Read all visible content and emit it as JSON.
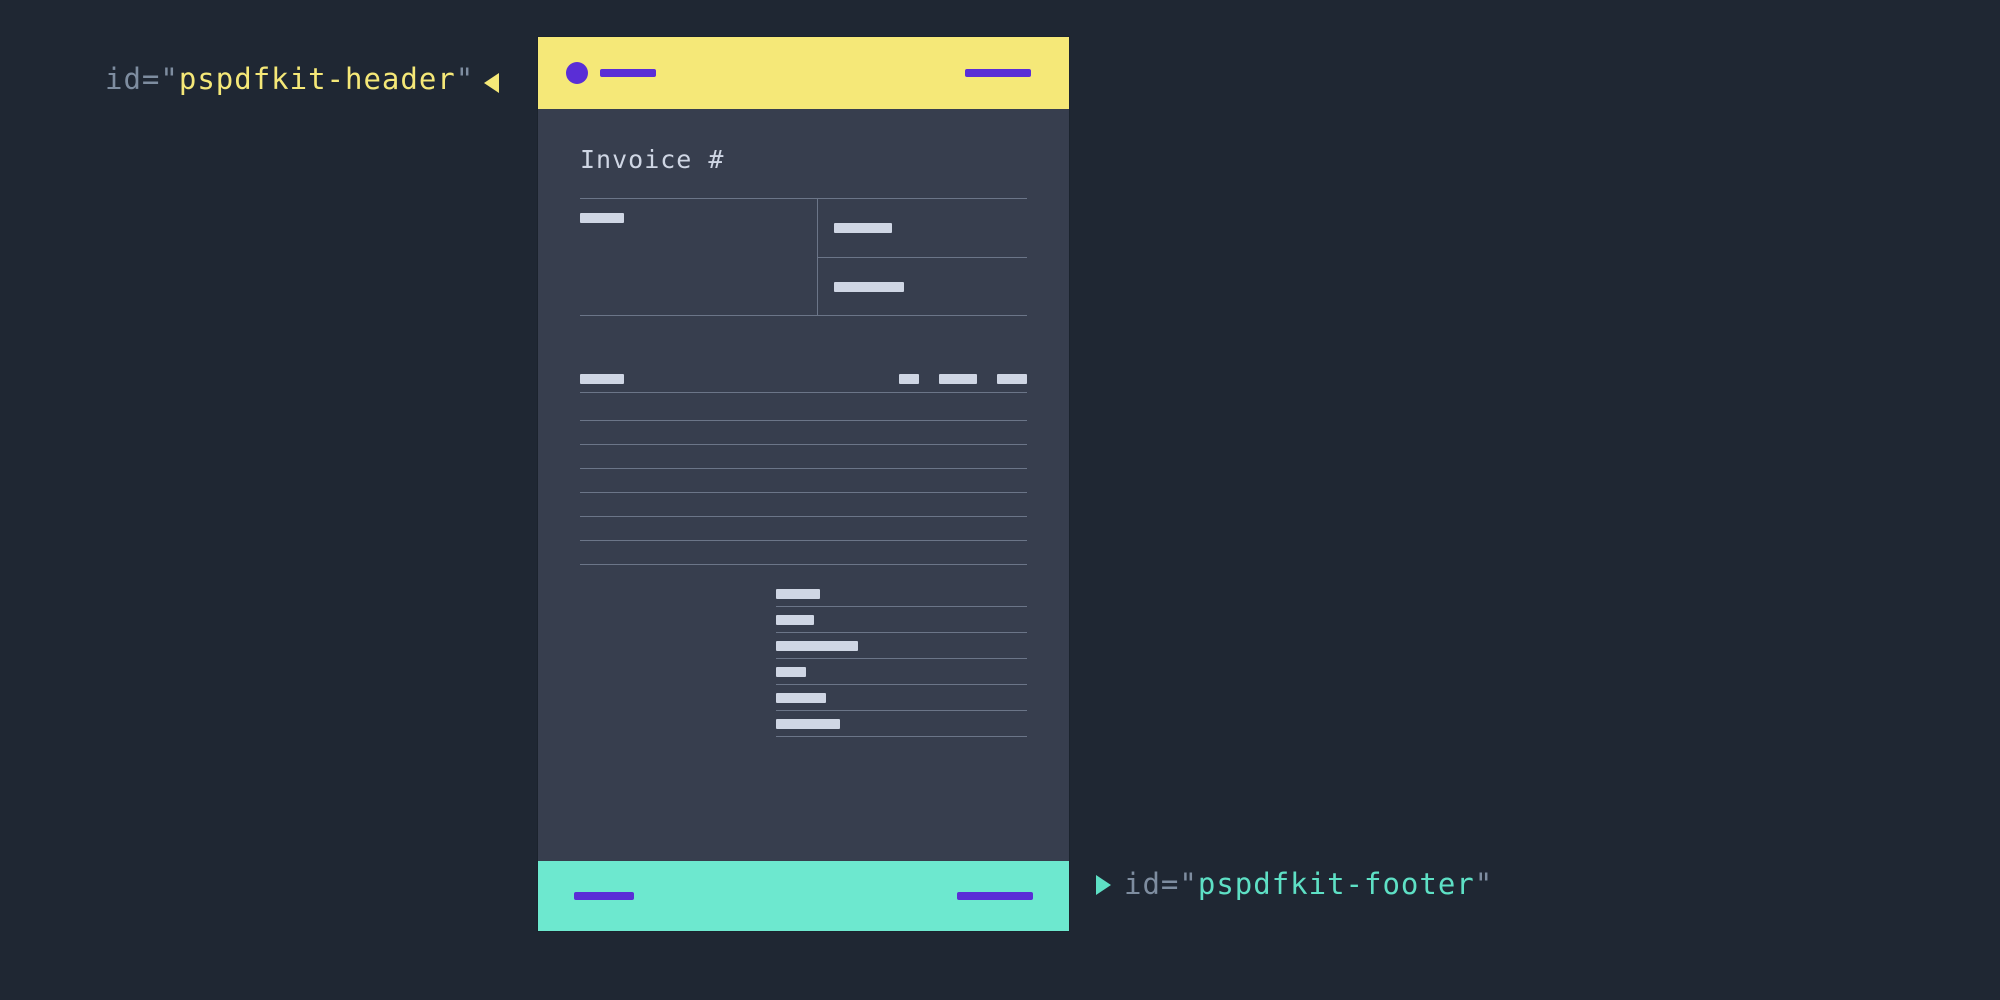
{
  "labels": {
    "header": {
      "attr": "id",
      "eq": "=",
      "q": "\"",
      "value": "pspdfkit-header"
    },
    "footer": {
      "attr": "id",
      "eq": "=",
      "q": "\"",
      "value": "pspdfkit-footer"
    }
  },
  "document": {
    "title": "Invoice #"
  }
}
